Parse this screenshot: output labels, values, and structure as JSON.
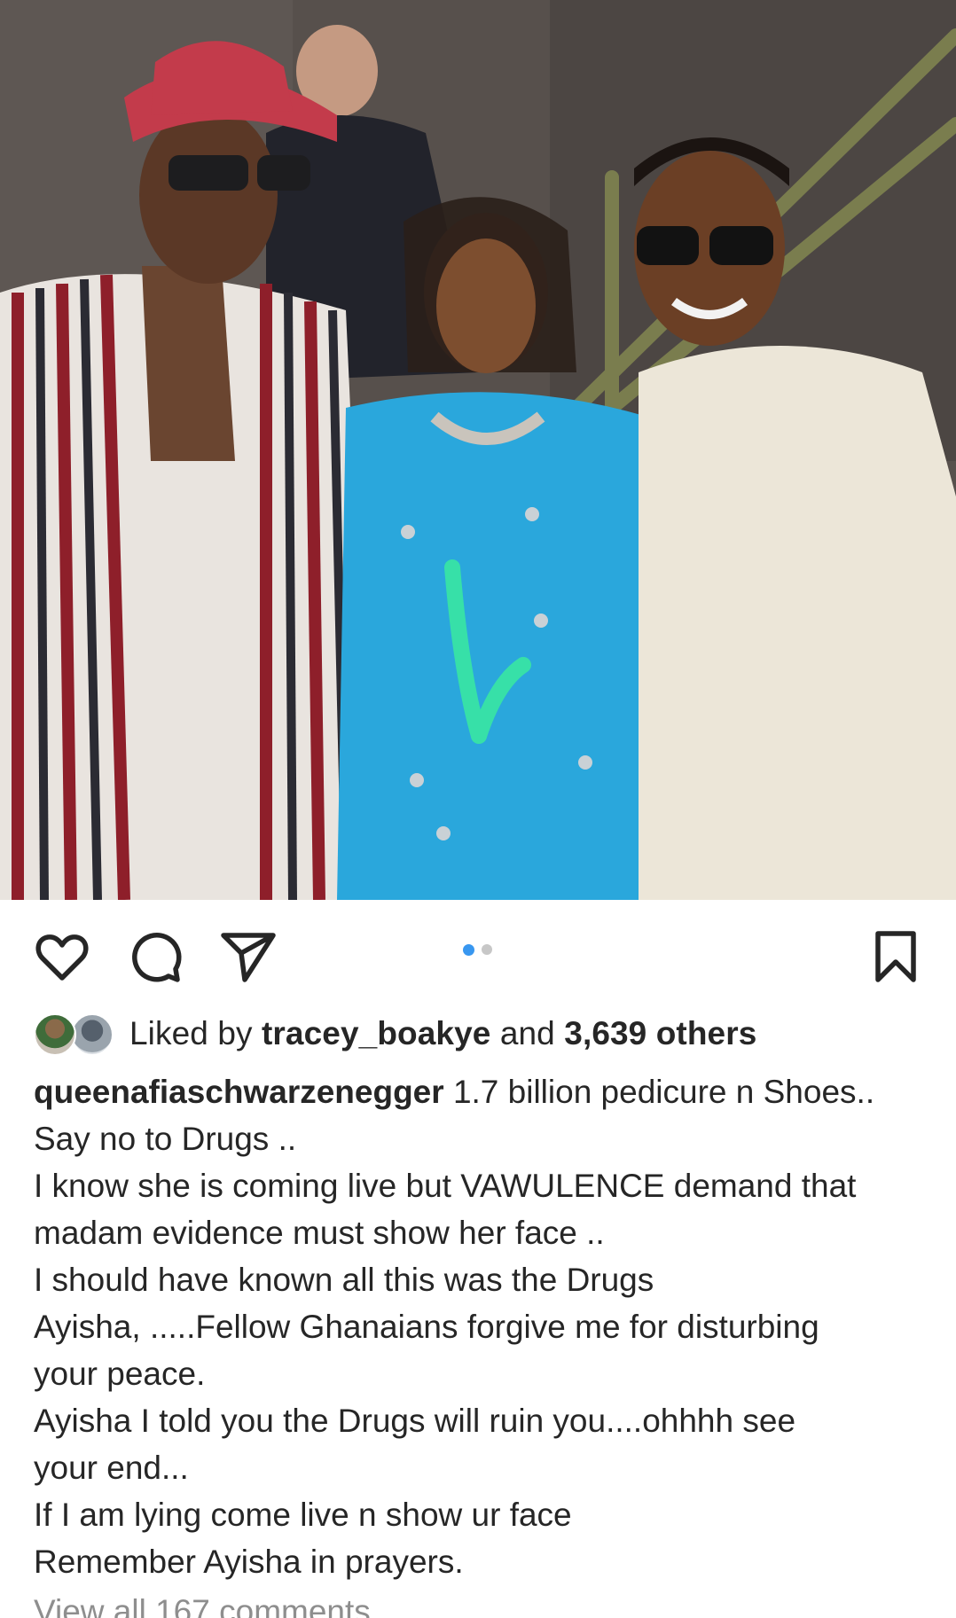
{
  "post": {
    "photo_alt": "three people posing in front of a staircase",
    "carousel": {
      "count": 2,
      "active_index": 0
    },
    "liked_by": {
      "prefix": "Liked by",
      "user": "tracey_boakye",
      "joiner": "and",
      "others": "3,639 others"
    },
    "caption": {
      "username": "queenafiaschwarzenegger",
      "first_line_text": "1.7 billion pedicure n Shoes..",
      "lines": [
        "Say no to Drugs ..",
        "I know she is coming live but VAWULENCE demand that",
        "madam evidence must show her face ..",
        "I should have  known all this was the Drugs",
        "Ayisha, .....Fellow Ghanaians forgive me for disturbing",
        "your peace.",
        "Ayisha I told you the  Drugs will ruin you....ohhhh see",
        "your end...",
        "If I am lying come live n show ur  face",
        "Remember Ayisha in prayers."
      ]
    },
    "view_comments": "View all 167 comments"
  },
  "icons": {
    "like": "heart-icon",
    "comment": "comment-icon",
    "share": "send-icon",
    "save": "bookmark-icon"
  },
  "colors": {
    "text": "#262626",
    "muted": "#8e8e8e",
    "carousel_active": "#3897f0",
    "carousel_inactive": "#c7c7c7"
  }
}
